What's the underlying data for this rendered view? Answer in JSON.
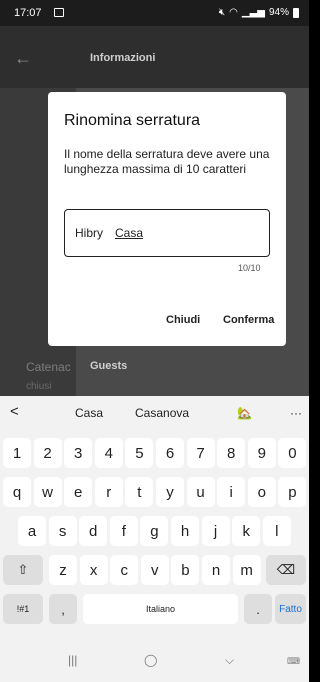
{
  "status_bar": {
    "time": "17:07",
    "battery": "94%"
  },
  "app": {
    "title": "Informazioni",
    "row_label": "Catenac",
    "row_status": "chiusi",
    "row_value": "Guests"
  },
  "dialog": {
    "title": "Rinomina serratura",
    "message": "Il nome della serratura deve avere una lunghezza massima di 10 caratteri",
    "input_value_part1": "Hibry",
    "input_value_part2": "Casa",
    "counter": "10/10",
    "close_label": "Chiudi",
    "confirm_label": "Conferma"
  },
  "keyboard": {
    "suggestions": [
      "Casa",
      "Casanova"
    ],
    "emoji": "🏡",
    "more": "···",
    "back": "<",
    "row_numbers": [
      "1",
      "2",
      "3",
      "4",
      "5",
      "6",
      "7",
      "8",
      "9",
      "0"
    ],
    "row1": [
      "q",
      "w",
      "e",
      "r",
      "t",
      "y",
      "u",
      "i",
      "o",
      "p"
    ],
    "row2": [
      "a",
      "s",
      "d",
      "f",
      "g",
      "h",
      "j",
      "k",
      "l"
    ],
    "row3": [
      "z",
      "x",
      "c",
      "v",
      "b",
      "n",
      "m"
    ],
    "symbols_key": "!#1",
    "comma_key": ",",
    "space_label": "Italiano",
    "period_key": ".",
    "done_label": "Fatto"
  },
  "icons": [
    "back-arrow-icon",
    "shift-icon",
    "backspace-icon",
    "recent-apps-icon",
    "home-icon",
    "back-icon",
    "keyboard-hide-icon"
  ]
}
